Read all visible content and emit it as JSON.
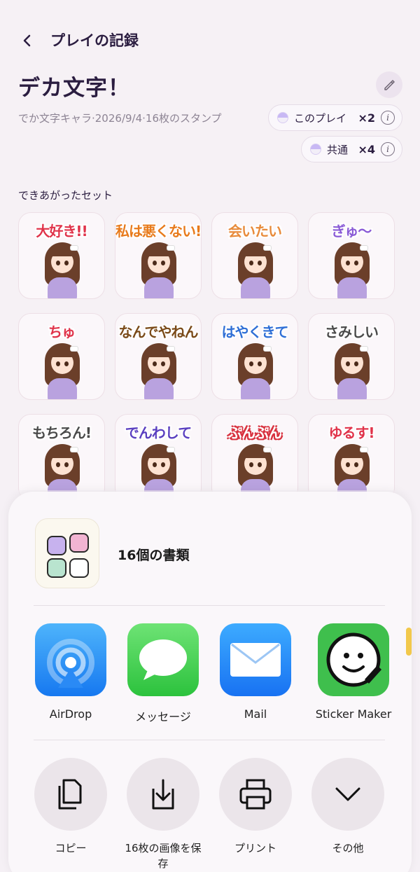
{
  "nav": {
    "back_icon": "chevron-left-icon",
    "title": "プレイの記録"
  },
  "record": {
    "title": "デカ文字！",
    "edit_icon": "pencil-icon",
    "meta": "でか文字キャラ·2026/9/4·16枚のスタンプ",
    "counts": [
      {
        "label": "このプレイ",
        "multiplier": "×2",
        "info": "i"
      },
      {
        "label": "共通",
        "multiplier": "×4",
        "info": "i"
      }
    ]
  },
  "section_label": "できあがったセット",
  "stickers": [
    {
      "caption": "大好き!!",
      "color": "#e0334a"
    },
    {
      "caption": "私は悪くない!",
      "color": "#e87a1b"
    },
    {
      "caption": "会いたい",
      "color": "#e88a3a"
    },
    {
      "caption": "ぎゅ〜",
      "color": "#8a5bd6"
    },
    {
      "caption": "ちゅ",
      "color": "#e0334a"
    },
    {
      "caption": "なんでやねん",
      "color": "#7a4a18"
    },
    {
      "caption": "はやくきて",
      "color": "#2f6fd6"
    },
    {
      "caption": "さみしい",
      "color": "#4a4a4a"
    },
    {
      "caption": "もちろん!",
      "color": "#4a4a4a"
    },
    {
      "caption": "でんわして",
      "color": "#5a3fc0"
    },
    {
      "caption": "ぷんぷん",
      "color": "#ffffff"
    },
    {
      "caption": "ゆるす!",
      "color": "#e0334a"
    }
  ],
  "share_sheet": {
    "document_count": "16個の書類",
    "apps": [
      {
        "label": "AirDrop",
        "icon": "airdrop-icon"
      },
      {
        "label": "メッセージ",
        "icon": "messages-icon"
      },
      {
        "label": "Mail",
        "icon": "mail-icon"
      },
      {
        "label": "Sticker Maker",
        "icon": "sticker-maker-icon"
      }
    ],
    "actions": [
      {
        "label": "コピー",
        "icon": "copy-icon"
      },
      {
        "label": "16枚の画像を保存",
        "icon": "save-image-icon"
      },
      {
        "label": "プリント",
        "icon": "print-icon"
      },
      {
        "label": "その他",
        "icon": "chevron-down-icon"
      }
    ]
  }
}
